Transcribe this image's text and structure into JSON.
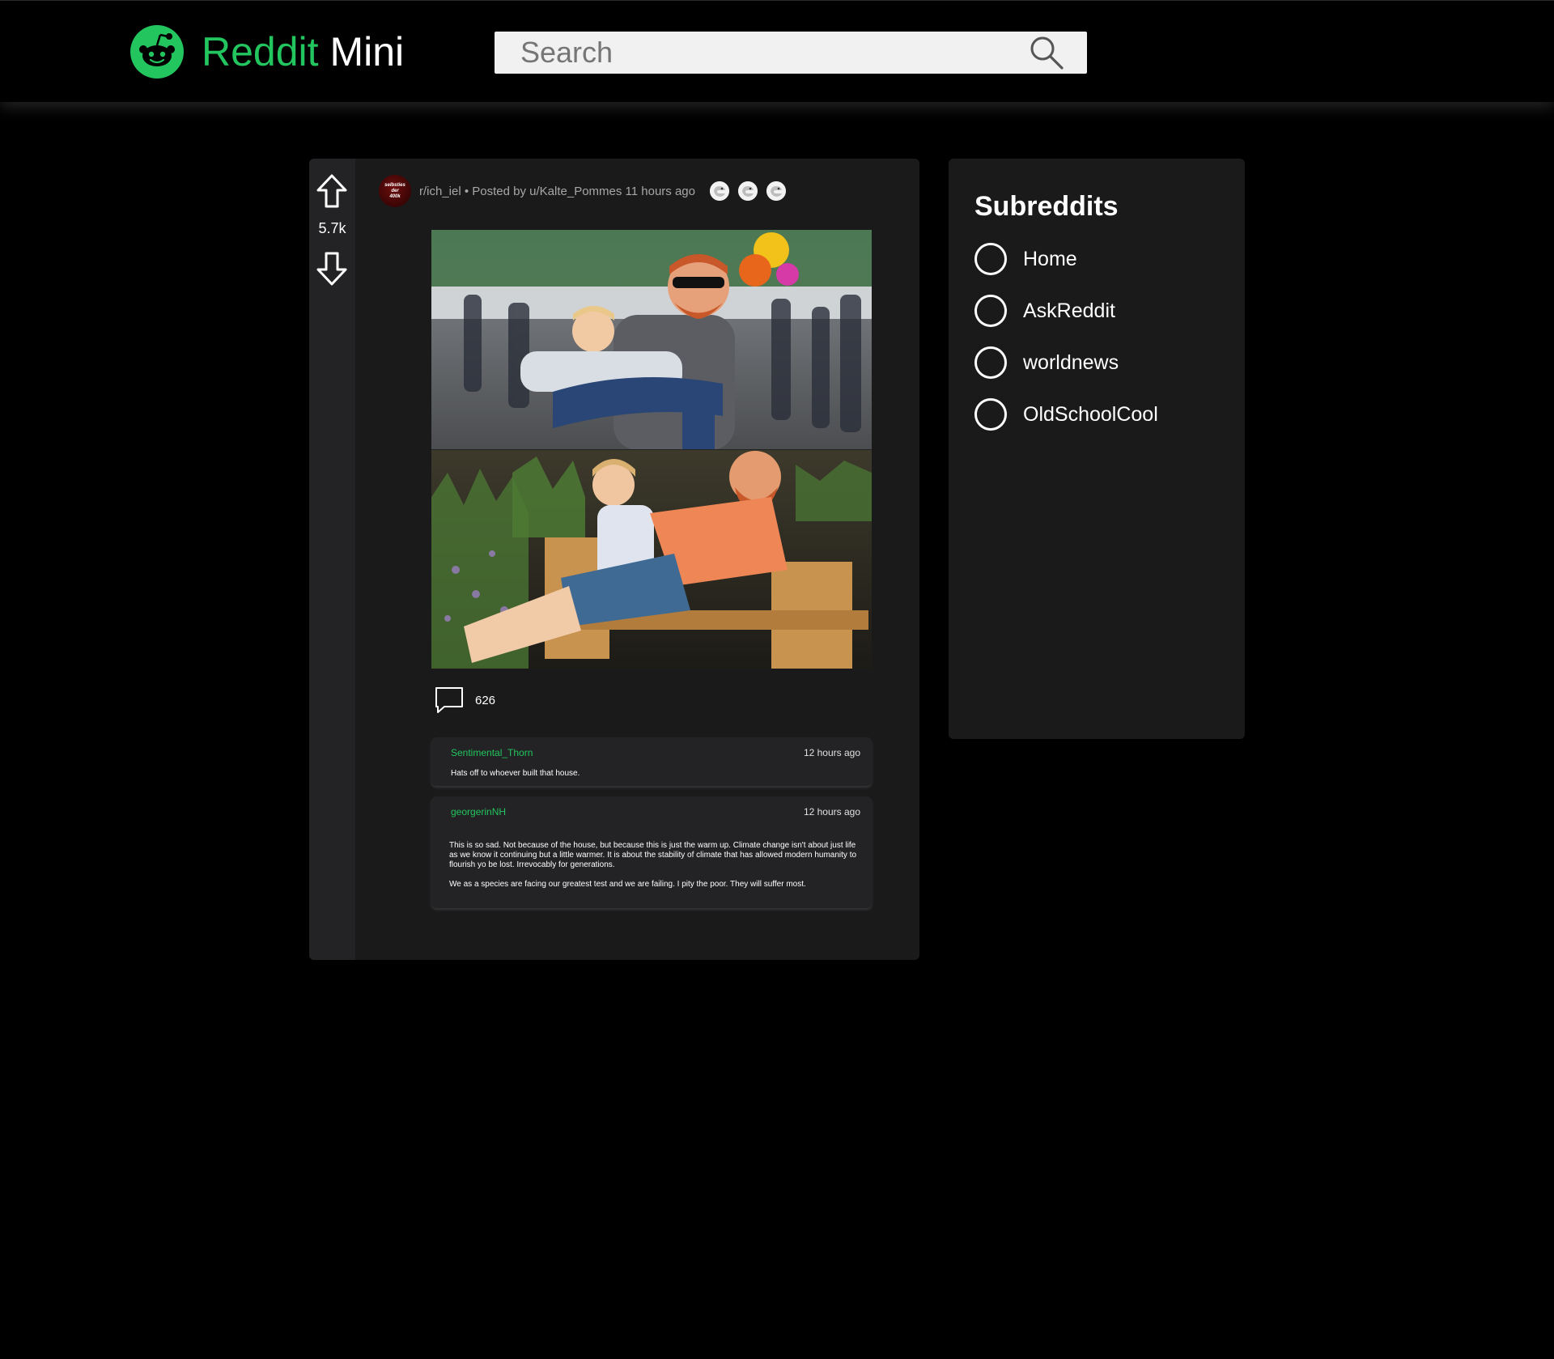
{
  "header": {
    "brand_first": "Reddit",
    "brand_second": "Mini",
    "search_placeholder": "Search"
  },
  "post": {
    "score": "5.7k",
    "subreddit_avatar_text": [
      "selbsties",
      "der",
      "400k"
    ],
    "meta": "r/ich_iel • Posted by u/Kalte_Pommes 11 hours ago",
    "award_count": 3,
    "comment_count": "626",
    "image_alt": "Two photos: a man carrying a boy at a graduation, and years later the grown boy carrying the man on a bench"
  },
  "comments": [
    {
      "author": "Sentimental_Thorn",
      "time": "12 hours ago",
      "body": [
        "Hats off to whoever built that house."
      ]
    },
    {
      "author": "georgerinNH",
      "time": "12 hours ago",
      "body": [
        "This is so sad. Not because of the house, but because this is just the warm up. Climate change isn't about just life as we know it continuing but a little warmer. It is about the stability of climate that has allowed modern humanity to flourish yo be lost. Irrevocably for generations.",
        "We as a species are facing our greatest test and we are failing. I pity the poor. They will suffer most."
      ]
    }
  ],
  "sidebar": {
    "title": "Subreddits",
    "items": [
      {
        "label": "Home"
      },
      {
        "label": "AskReddit"
      },
      {
        "label": "worldnews"
      },
      {
        "label": "OldSchoolCool"
      }
    ]
  },
  "colors": {
    "accent": "#22c55e",
    "background": "#000000",
    "card": "#1a1a1b",
    "vote_column": "#232325",
    "comment_card": "#232325"
  },
  "icons": [
    "reddit-logo-icon",
    "search-icon",
    "upvote-arrow-icon",
    "downvote-arrow-icon",
    "award-icon",
    "comment-bubble-icon",
    "radio-icon"
  ]
}
